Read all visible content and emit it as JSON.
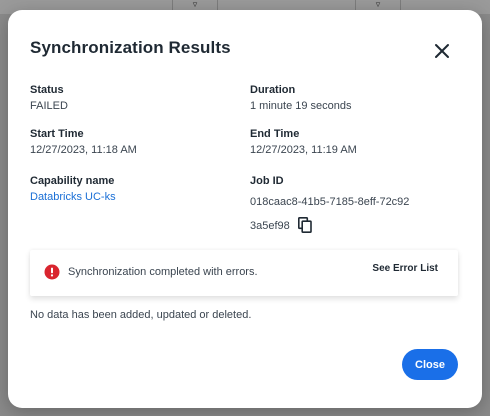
{
  "modal": {
    "title": "Synchronization Results",
    "fields": {
      "status": {
        "label": "Status",
        "value": "FAILED"
      },
      "duration": {
        "label": "Duration",
        "value": "1 minute 19 seconds"
      },
      "start_time": {
        "label": "Start Time",
        "value": "12/27/2023, 11:18 AM"
      },
      "end_time": {
        "label": "End Time",
        "value": "12/27/2023, 11:19 AM"
      },
      "capability": {
        "label": "Capability name",
        "value": "Databricks UC-ks"
      },
      "job_id": {
        "label": "Job ID",
        "value": "018caac8-41b5-7185-8eff-72c923a5ef98"
      }
    },
    "alert": {
      "message": "Synchronization completed with errors.",
      "link_label": "See Error List",
      "color": "#d9252f"
    },
    "note": "No data has been added, updated or deleted.",
    "close_label": "Close",
    "accent_color": "#1a6fe8"
  },
  "icons": {
    "close": "close-icon",
    "copy": "copy-icon",
    "error": "error-circle-icon",
    "filter": "filter-icon"
  }
}
